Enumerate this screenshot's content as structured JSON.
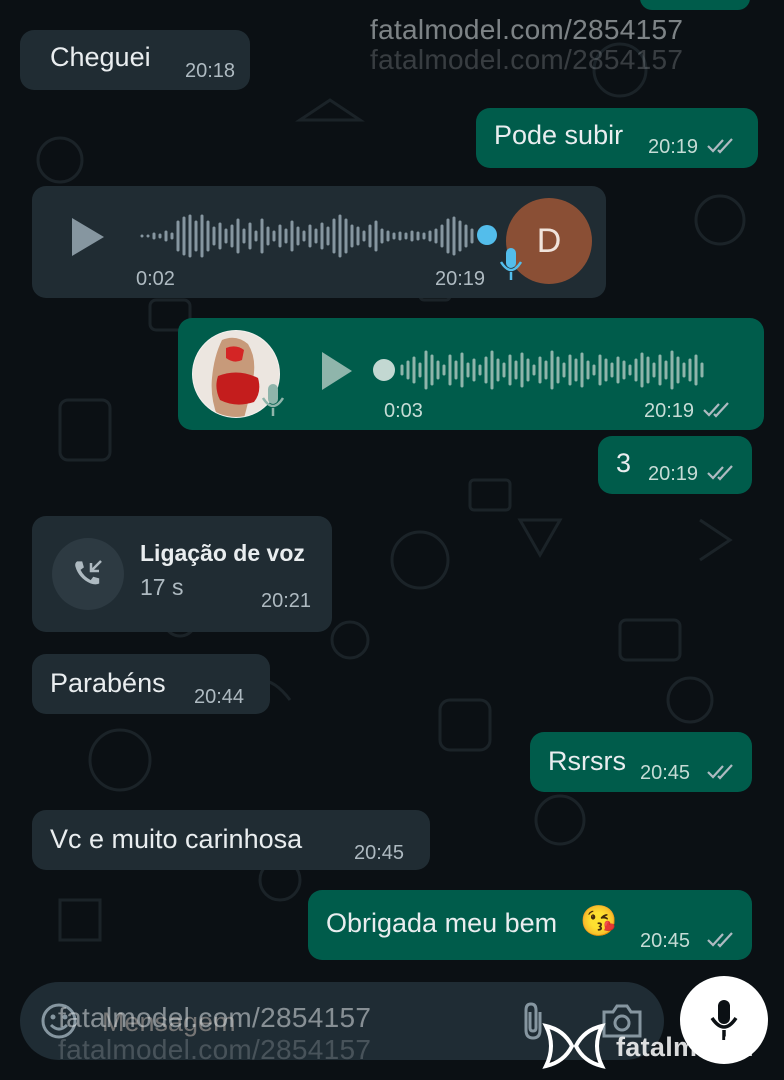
{
  "watermarks": {
    "top": "fatalmodel.com/2854157",
    "top_faint": "fatalmodel.com/2854157",
    "bottom": "fatalmodel.com/2854157",
    "bottom_faint": "fatalmodel.com/2854157",
    "logo_text": "fatalmodel"
  },
  "messages": {
    "m1": {
      "text": "Cheguei",
      "time": "20:18"
    },
    "m2": {
      "text": "Pode subir",
      "time": "20:19"
    },
    "voice_in": {
      "duration": "0:02",
      "time": "20:19",
      "avatar_letter": "D"
    },
    "voice_out": {
      "duration": "0:03",
      "time": "20:19"
    },
    "m3": {
      "text": "3",
      "time": "20:19"
    },
    "call": {
      "title": "Ligação de voz",
      "duration": "17 s",
      "time": "20:21"
    },
    "m4": {
      "text": "Parabéns",
      "time": "20:44"
    },
    "m5": {
      "text": "Rsrsrs",
      "time": "20:45"
    },
    "m6": {
      "text": "Vc e muito carinhosa",
      "time": "20:45"
    },
    "m7": {
      "text": "Obrigada meu bem",
      "emoji": "😘",
      "time": "20:45"
    }
  },
  "composer": {
    "placeholder": "Mensagem"
  },
  "icons": {
    "emoji": "emoji-icon",
    "attach": "paperclip-icon",
    "camera": "camera-icon",
    "mic": "mic-icon",
    "play": "play-icon",
    "call": "incoming-call-icon",
    "read": "double-check-icon"
  },
  "colors": {
    "background": "#0b1014",
    "incoming_bubble": "#202c33",
    "outgoing_bubble": "#005c4b",
    "voice_dot": "#53bdeb",
    "avatar": "#8a4f35"
  }
}
